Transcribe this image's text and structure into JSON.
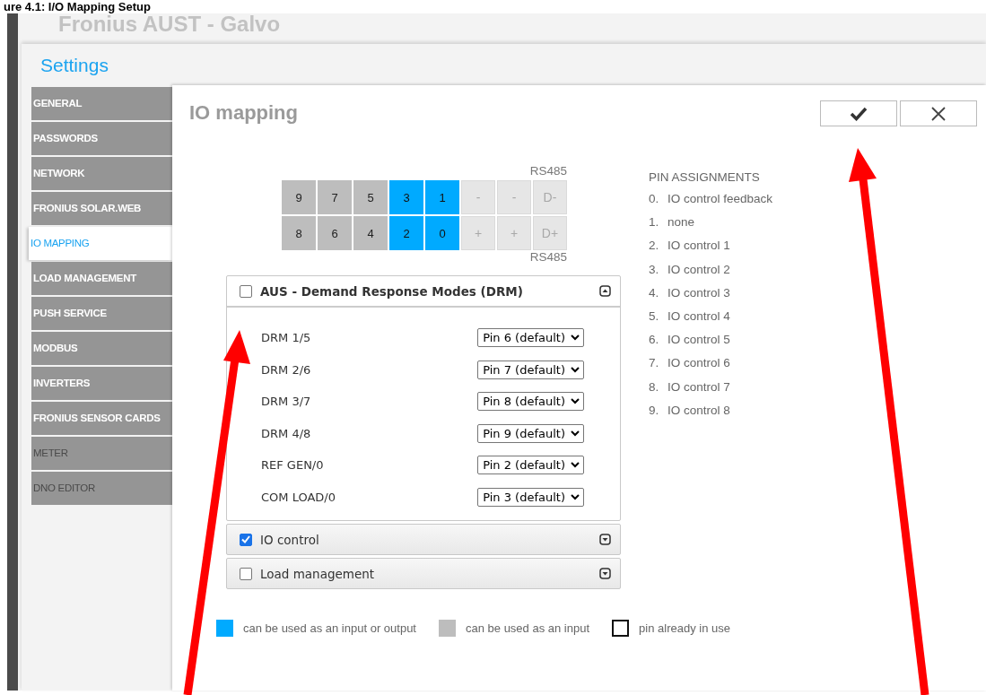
{
  "caption": "ure 4.1: I/O Mapping Setup",
  "app_title": "Fronius AUST - Galvo",
  "settings_title": "Settings",
  "sidebar": {
    "items": [
      {
        "label": "GENERAL",
        "selected": false,
        "disabled": false
      },
      {
        "label": "PASSWORDS",
        "selected": false,
        "disabled": false
      },
      {
        "label": "NETWORK",
        "selected": false,
        "disabled": false
      },
      {
        "label": "FRONIUS SOLAR.WEB",
        "selected": false,
        "disabled": false
      },
      {
        "label": "IO MAPPING",
        "selected": true,
        "disabled": false
      },
      {
        "label": "LOAD MANAGEMENT",
        "selected": false,
        "disabled": false
      },
      {
        "label": "PUSH SERVICE",
        "selected": false,
        "disabled": false
      },
      {
        "label": "MODBUS",
        "selected": false,
        "disabled": false
      },
      {
        "label": "INVERTERS",
        "selected": false,
        "disabled": false
      },
      {
        "label": "FRONIUS SENSOR CARDS",
        "selected": false,
        "disabled": false
      },
      {
        "label": "METER",
        "selected": false,
        "disabled": true
      },
      {
        "label": "DNO EDITOR",
        "selected": false,
        "disabled": true
      }
    ]
  },
  "page_title": "IO mapping",
  "pin_header": {
    "top_label": "RS485",
    "bottom_label": "RS485",
    "rows": [
      [
        {
          "label": "9",
          "kind": "input"
        },
        {
          "label": "7",
          "kind": "input"
        },
        {
          "label": "5",
          "kind": "input"
        },
        {
          "label": "3",
          "kind": "io"
        },
        {
          "label": "1",
          "kind": "io"
        },
        {
          "label": "-",
          "kind": "unavailable"
        },
        {
          "label": "-",
          "kind": "unavailable"
        },
        {
          "label": "D-",
          "kind": "unavailable"
        }
      ],
      [
        {
          "label": "8",
          "kind": "input"
        },
        {
          "label": "6",
          "kind": "input"
        },
        {
          "label": "4",
          "kind": "input"
        },
        {
          "label": "2",
          "kind": "io"
        },
        {
          "label": "0",
          "kind": "io"
        },
        {
          "label": "+",
          "kind": "unavailable"
        },
        {
          "label": "+",
          "kind": "unavailable"
        },
        {
          "label": "D+",
          "kind": "unavailable"
        }
      ]
    ]
  },
  "pin_assignments": {
    "title": "PIN ASSIGNMENTS",
    "items": [
      {
        "number": "0.",
        "text": "IO control feedback"
      },
      {
        "number": "1.",
        "text": "none"
      },
      {
        "number": "2.",
        "text": "IO control 1"
      },
      {
        "number": "3.",
        "text": "IO control 2"
      },
      {
        "number": "4.",
        "text": "IO control 3"
      },
      {
        "number": "5.",
        "text": "IO control 4"
      },
      {
        "number": "6.",
        "text": "IO control 5"
      },
      {
        "number": "7.",
        "text": "IO control 6"
      },
      {
        "number": "8.",
        "text": "IO control 7"
      },
      {
        "number": "9.",
        "text": "IO control 8"
      }
    ]
  },
  "sections": [
    {
      "title": "AUS - Demand Response Modes (DRM)",
      "checked": false,
      "expanded": true,
      "rows": [
        {
          "label": "DRM 1/5",
          "value": "Pin 6 (default)"
        },
        {
          "label": "DRM 2/6",
          "value": "Pin 7 (default)"
        },
        {
          "label": "DRM 3/7",
          "value": "Pin 8 (default)"
        },
        {
          "label": "DRM 4/8",
          "value": "Pin 9 (default)"
        },
        {
          "label": "REF GEN/0",
          "value": "Pin 2 (default)"
        },
        {
          "label": "COM LOAD/0",
          "value": "Pin 3 (default)"
        }
      ]
    },
    {
      "title": "IO control",
      "checked": true,
      "expanded": false
    },
    {
      "title": "Load management",
      "checked": false,
      "expanded": false
    }
  ],
  "legend": [
    {
      "kind": "io",
      "text": "can be used as an input or output"
    },
    {
      "kind": "input",
      "text": "can be used as an input"
    },
    {
      "kind": "in_use",
      "text": "pin already in use"
    }
  ]
}
